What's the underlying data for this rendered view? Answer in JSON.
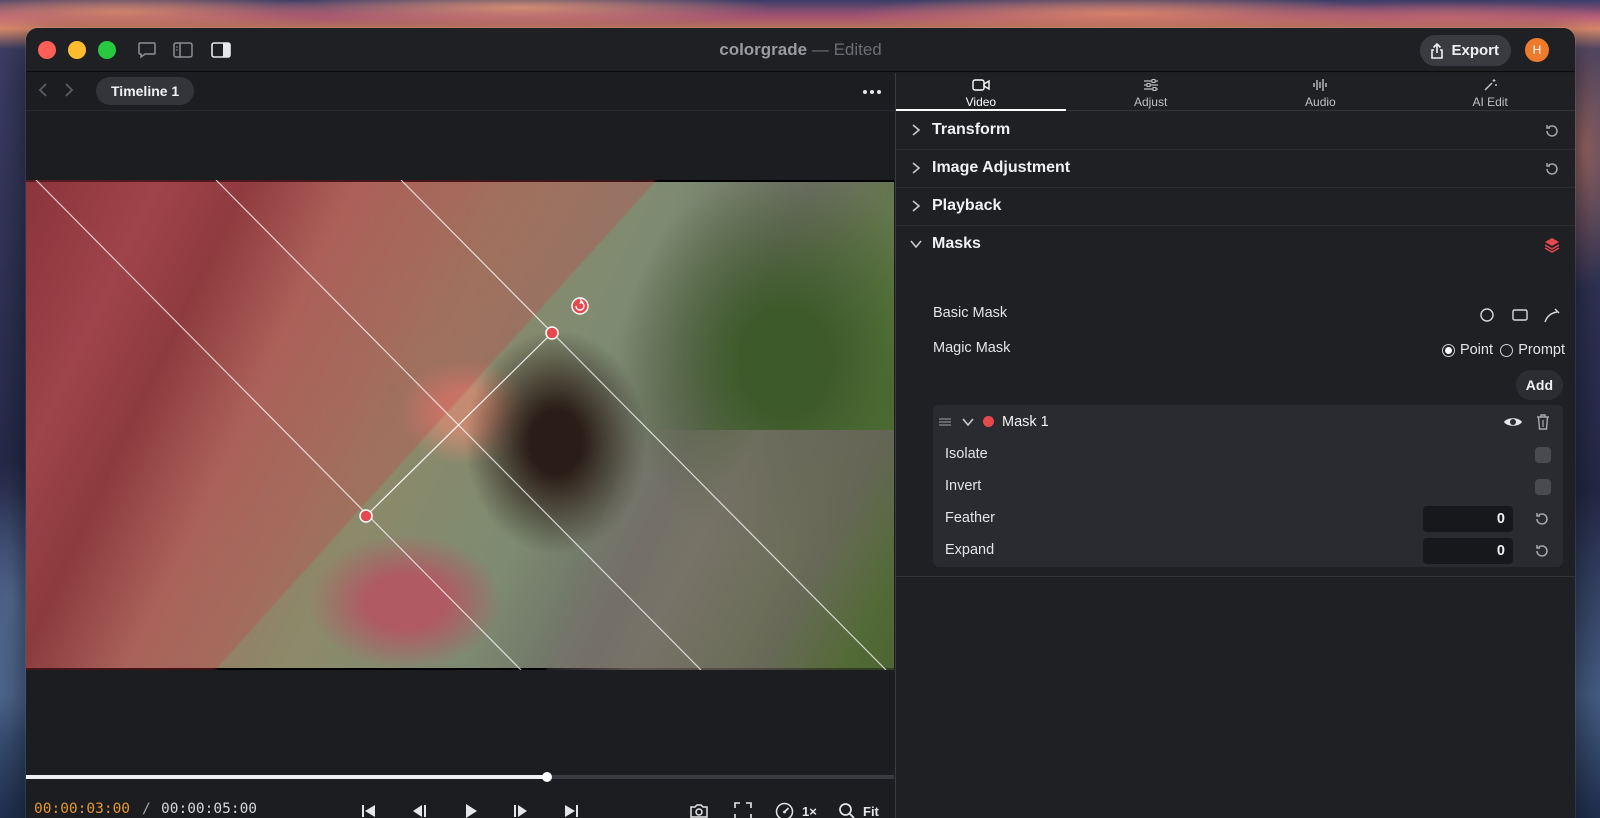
{
  "window": {
    "title": "colorgrade",
    "separator": "—",
    "status": "Edited"
  },
  "titlebar": {
    "export_label": "Export",
    "avatar_initial": "H"
  },
  "viewer": {
    "timeline_label": "Timeline 1",
    "current_time": "00:00:03:00",
    "time_separator": "/",
    "total_time": "00:00:05:00",
    "playback_progress": 0.6,
    "speed_label": "1×",
    "zoom_label": "Fit"
  },
  "inspector": {
    "tabs": [
      {
        "label": "Video",
        "icon": "video-camera-icon",
        "active": true
      },
      {
        "label": "Adjust",
        "icon": "sliders-icon",
        "active": false
      },
      {
        "label": "Audio",
        "icon": "waveform-icon",
        "active": false
      },
      {
        "label": "AI Edit",
        "icon": "magic-wand-icon",
        "active": false
      }
    ],
    "sections": {
      "transform": "Transform",
      "image_adjustment": "Image Adjustment",
      "playback": "Playback",
      "masks": "Masks"
    },
    "masks": {
      "basic_mask_label": "Basic Mask",
      "magic_mask_label": "Magic Mask",
      "point_option": "Point",
      "prompt_option": "Prompt",
      "selected_option": "Point",
      "add_label": "Add",
      "mask_item": {
        "name": "Mask 1",
        "color": "#e5484d",
        "isolate_label": "Isolate",
        "invert_label": "Invert",
        "feather_label": "Feather",
        "feather_value": "0",
        "expand_label": "Expand",
        "expand_value": "0"
      }
    }
  },
  "colors": {
    "accent_timecode": "#e8962e",
    "mask_red": "#e5484d",
    "masks_layers_icon": "#e5484d",
    "avatar": "#ee7a2c"
  }
}
